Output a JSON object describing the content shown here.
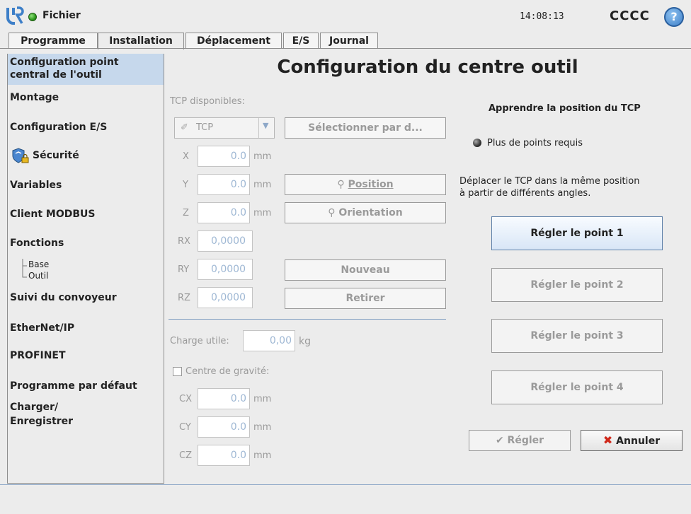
{
  "header": {
    "file_menu": "Fichier",
    "clock": "14:08:13",
    "robot_name": "CCCC",
    "help": "?"
  },
  "tabs": [
    {
      "label": "Programme",
      "active": false
    },
    {
      "label": "Installation",
      "active": true
    },
    {
      "label": "Déplacement",
      "active": false
    },
    {
      "label": "E/S",
      "active": false
    },
    {
      "label": "Journal",
      "active": false
    }
  ],
  "sidebar": {
    "items": [
      {
        "label_line1": "Configuration point",
        "label_line2": "central de l'outil",
        "selected": true
      },
      {
        "label": "Montage"
      },
      {
        "label": "Configuration E/S"
      },
      {
        "label": "Sécurité"
      },
      {
        "label": "Variables"
      },
      {
        "label": "Client MODBUS"
      },
      {
        "label": "Fonctions"
      },
      {
        "label": "Suivi du convoyeur"
      },
      {
        "label": "EtherNet/IP"
      },
      {
        "label": "PROFINET"
      },
      {
        "label": "Programme par défaut"
      },
      {
        "label_line1": "Charger/",
        "label_line2": "Enregistrer"
      }
    ],
    "sub_items": [
      "Base",
      "Outil"
    ]
  },
  "main": {
    "title": "Configuration du centre outil",
    "tcp_label": "TCP disponibles:",
    "tcp_select": "TCP",
    "select_default_button": "Sélectionner par d...",
    "position_button": "Position",
    "orientation_button": "Orientation",
    "new_button": "Nouveau",
    "remove_button": "Retirer",
    "coords": [
      {
        "axis": "X",
        "value": "0.0",
        "unit": "mm"
      },
      {
        "axis": "Y",
        "value": "0.0",
        "unit": "mm"
      },
      {
        "axis": "Z",
        "value": "0.0",
        "unit": "mm"
      },
      {
        "axis": "RX",
        "value": "0,0000",
        "unit": ""
      },
      {
        "axis": "RY",
        "value": "0,0000",
        "unit": ""
      },
      {
        "axis": "RZ",
        "value": "0,0000",
        "unit": ""
      }
    ],
    "payload_label": "Charge utile:",
    "payload_value": "0,00",
    "payload_unit": "kg",
    "cog_label": "Centre de gravité:",
    "cog": [
      {
        "axis": "CX",
        "value": "0.0",
        "unit": "mm"
      },
      {
        "axis": "CY",
        "value": "0.0",
        "unit": "mm"
      },
      {
        "axis": "CZ",
        "value": "0.0",
        "unit": "mm"
      }
    ]
  },
  "teach": {
    "title": "Apprendre la position du TCP",
    "status": "Plus de points requis",
    "instructions_line1": "Déplacer le TCP dans la même position",
    "instructions_line2": "à partir de différents angles.",
    "points": [
      "Régler le point 1",
      "Régler le point 2",
      "Régler le point 3",
      "Régler le point 4"
    ],
    "set_button": "Régler",
    "cancel_button": "Annuler"
  },
  "colors": {
    "selected_bg": "#c6d8ec",
    "cancel_icon": "#d0281a",
    "status_dot": "#2e9a1e"
  }
}
